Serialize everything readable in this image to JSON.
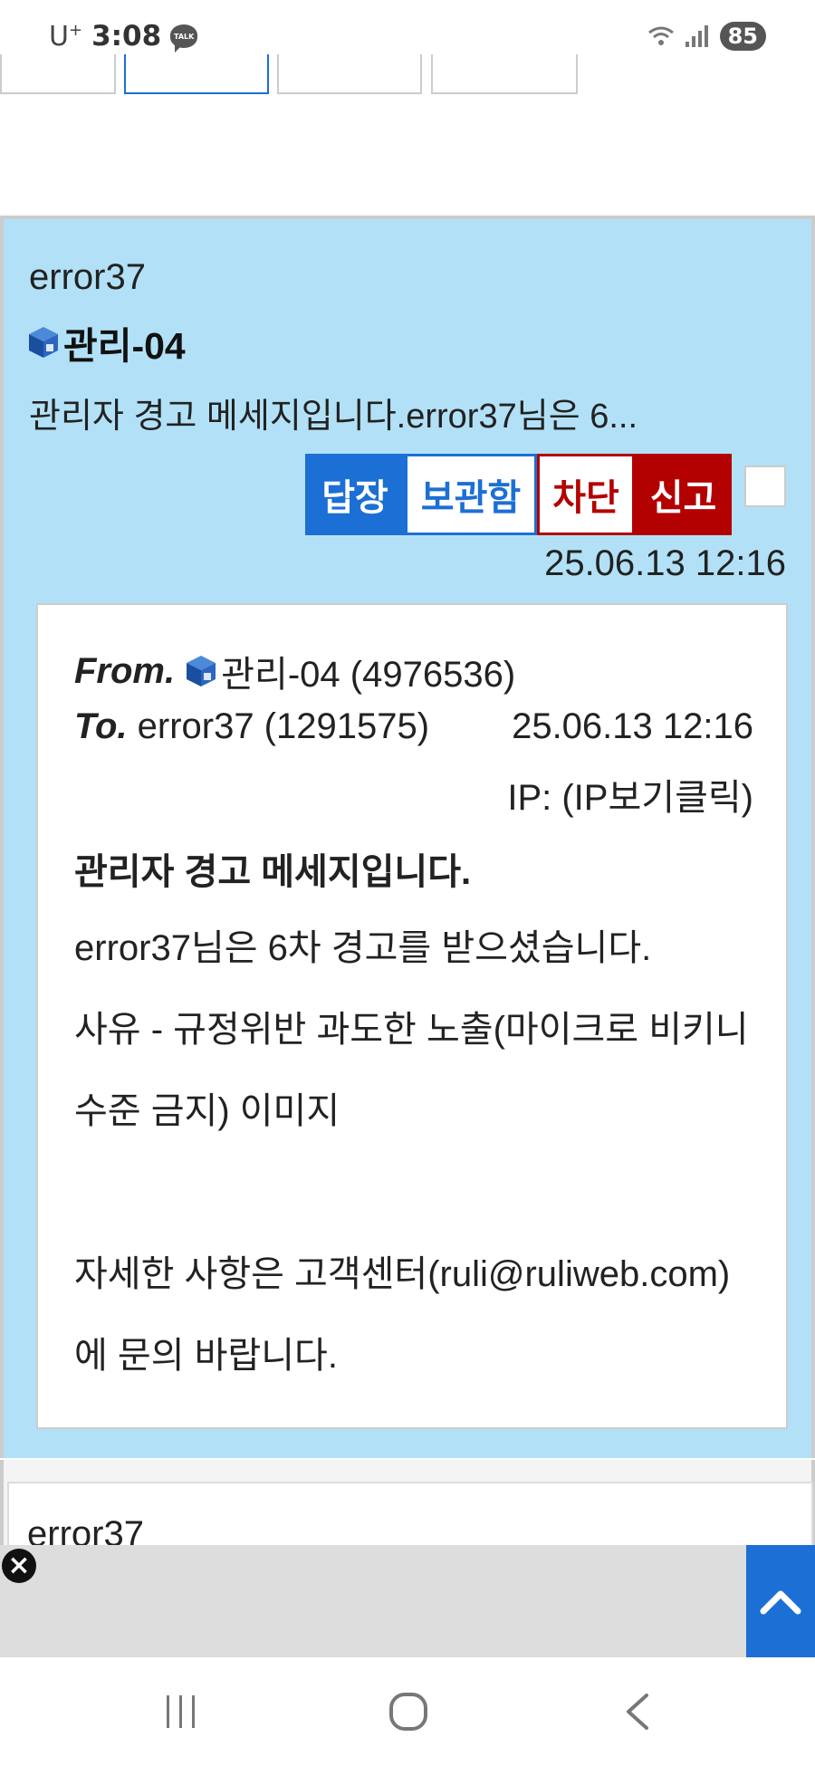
{
  "status_bar": {
    "carrier": "U",
    "carrier_sup": "+",
    "time": "3:08",
    "talk_badge": "TALK",
    "battery": "85"
  },
  "message": {
    "sender_id": "error37",
    "sender_name": "관리-04",
    "preview": "관리자 경고 메세지입니다.error37님은 6...",
    "buttons": {
      "reply": "답장",
      "archive": "보관함",
      "block": "차단",
      "report": "신고"
    },
    "date": "25.06.13 12:16",
    "detail": {
      "from_label": "From.",
      "from_value": "관리-04 (4976536)",
      "to_label": "To.",
      "to_value": "error37 (1291575)",
      "date": "25.06.13 12:16",
      "ip": "IP: (IP보기클릭)",
      "subject": "관리자 경고 메세지입니다.",
      "body": [
        "error37님은 6차 경고를 받으셨습니다.",
        "사유 - 규정위반 과도한 노출(마이크로 비키니 수준 금지) 이미지",
        "",
        "자세한 사항은 고객센터(ruli@ruliweb.com)에 문의 바랍니다."
      ]
    }
  },
  "next_message": {
    "sender_id": "error37"
  },
  "colors": {
    "card_bg": "#b2e1f7",
    "accent_blue": "#1c6fd4",
    "accent_red": "#b30000"
  },
  "icons": [
    "talk-icon",
    "wifi-icon",
    "signal-icon",
    "cube-icon",
    "close-icon",
    "chevron-up-icon",
    "recent-apps-icon",
    "home-icon",
    "back-icon"
  ]
}
